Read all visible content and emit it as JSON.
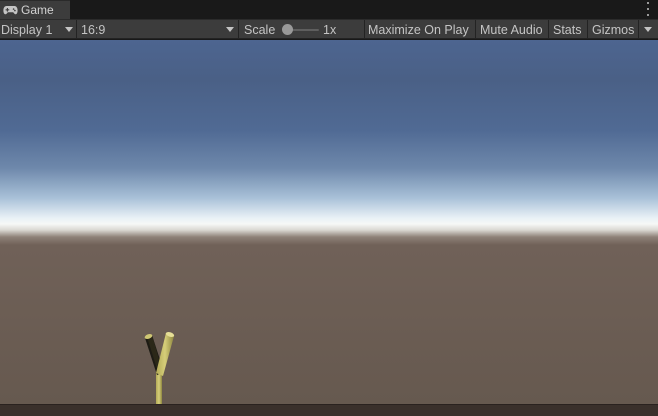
{
  "tab": {
    "title": "Game",
    "icon": "gamepad-icon"
  },
  "toolbar": {
    "display_label": "Display 1",
    "aspect_label": "16:9",
    "scale_label": "Scale",
    "scale_value": "1x",
    "scale_slider_fraction": 0.0,
    "maximize_label": "Maximize On Play",
    "mute_label": "Mute Audio",
    "stats_label": "Stats",
    "gizmos_label": "Gizmos"
  },
  "colors": {
    "panel_bg": "#3c3c3c",
    "tab_strip_bg": "#191919",
    "text": "#c4c4c4",
    "sky_top": "#4d6590",
    "horizon": "#f6f8f6",
    "ground": "#66594f",
    "slingshot": "#c9c067"
  }
}
